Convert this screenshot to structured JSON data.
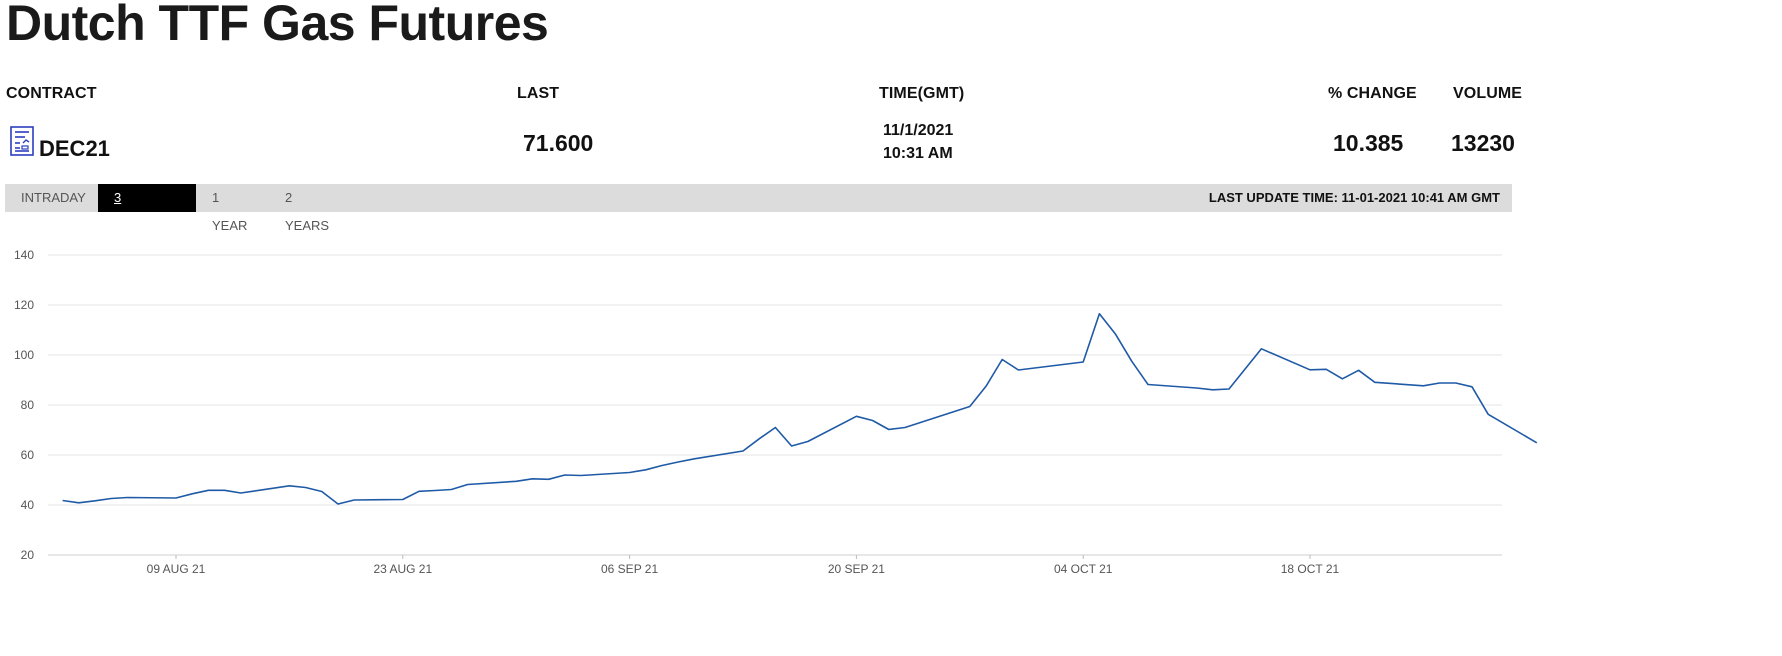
{
  "page": {
    "title": "Dutch TTF Gas Futures"
  },
  "quote": {
    "headers": {
      "contract": "CONTRACT",
      "last": "LAST",
      "time": "TIME(GMT)",
      "pct_change": "% CHANGE",
      "volume": "VOLUME"
    },
    "contract": "DEC21",
    "last": "71.600",
    "date": "11/1/2021",
    "time": "10:31 AM",
    "pct_change": "10.385",
    "volume": "13230",
    "icon": "contract-sheet-icon"
  },
  "tabs": [
    {
      "label": "INTRADAY",
      "active": false
    },
    {
      "label": "3 MONTHS",
      "active": true
    },
    {
      "label": "1 YEAR",
      "active": false
    },
    {
      "label": "2 YEARS",
      "active": false
    }
  ],
  "last_update": "LAST UPDATE TIME: 11-01-2021 10:41 AM GMT",
  "colors": {
    "line": "#1f5aa6",
    "grid": "#e6e6e6",
    "tabbar": "#dcdcdc",
    "active_tab": "#000000"
  },
  "chart_data": {
    "type": "line",
    "ylim": [
      20,
      140
    ],
    "yticks": [
      140,
      120,
      100,
      80,
      60,
      40,
      20
    ],
    "grid": "horizontal",
    "xticks": [
      {
        "label": "09 AUG 21",
        "date": "2021-08-09"
      },
      {
        "label": "23 AUG 21",
        "date": "2021-08-23"
      },
      {
        "label": "06 SEP 21",
        "date": "2021-09-06"
      },
      {
        "label": "20 SEP 21",
        "date": "2021-09-20"
      },
      {
        "label": "04 OCT 21",
        "date": "2021-10-04"
      },
      {
        "label": "18 OCT 21",
        "date": "2021-10-18"
      }
    ],
    "series": [
      {
        "points": [
          [
            "2021-08-02",
            41.8
          ],
          [
            "2021-08-03",
            40.9
          ],
          [
            "2021-08-04",
            41.7
          ],
          [
            "2021-08-05",
            42.6
          ],
          [
            "2021-08-06",
            43.0
          ],
          [
            "2021-08-09",
            42.8
          ],
          [
            "2021-08-10",
            44.5
          ],
          [
            "2021-08-11",
            45.9
          ],
          [
            "2021-08-12",
            45.9
          ],
          [
            "2021-08-13",
            44.8
          ],
          [
            "2021-08-16",
            47.7
          ],
          [
            "2021-08-17",
            47.0
          ],
          [
            "2021-08-18",
            45.4
          ],
          [
            "2021-08-19",
            40.4
          ],
          [
            "2021-08-20",
            42.0
          ],
          [
            "2021-08-23",
            42.2
          ],
          [
            "2021-08-24",
            45.5
          ],
          [
            "2021-08-25",
            45.8
          ],
          [
            "2021-08-26",
            46.2
          ],
          [
            "2021-08-27",
            48.2
          ],
          [
            "2021-08-30",
            49.5
          ],
          [
            "2021-08-31",
            50.5
          ],
          [
            "2021-09-01",
            50.3
          ],
          [
            "2021-09-02",
            52.0
          ],
          [
            "2021-09-03",
            51.8
          ],
          [
            "2021-09-06",
            53.0
          ],
          [
            "2021-09-07",
            54.1
          ],
          [
            "2021-09-08",
            55.8
          ],
          [
            "2021-09-09",
            57.2
          ],
          [
            "2021-09-10",
            58.5
          ],
          [
            "2021-09-13",
            61.6
          ],
          [
            "2021-09-14",
            66.5
          ],
          [
            "2021-09-15",
            71.0
          ],
          [
            "2021-09-16",
            63.6
          ],
          [
            "2021-09-17",
            65.4
          ],
          [
            "2021-09-20",
            75.5
          ],
          [
            "2021-09-21",
            73.8
          ],
          [
            "2021-09-22",
            70.2
          ],
          [
            "2021-09-23",
            71.0
          ],
          [
            "2021-09-27",
            79.4
          ],
          [
            "2021-09-28",
            87.5
          ],
          [
            "2021-09-29",
            98.2
          ],
          [
            "2021-09-30",
            94.0
          ],
          [
            "2021-10-01",
            94.8
          ],
          [
            "2021-10-04",
            97.2
          ],
          [
            "2021-10-05",
            116.5
          ],
          [
            "2021-10-06",
            108.3
          ],
          [
            "2021-10-07",
            97.5
          ],
          [
            "2021-10-08",
            88.2
          ],
          [
            "2021-10-11",
            86.8
          ],
          [
            "2021-10-12",
            86.1
          ],
          [
            "2021-10-13",
            86.4
          ],
          [
            "2021-10-15",
            102.5
          ],
          [
            "2021-10-18",
            94.1
          ],
          [
            "2021-10-19",
            94.3
          ],
          [
            "2021-10-20",
            90.5
          ],
          [
            "2021-10-21",
            93.9
          ],
          [
            "2021-10-22",
            89.1
          ],
          [
            "2021-10-25",
            87.7
          ],
          [
            "2021-10-26",
            88.8
          ],
          [
            "2021-10-27",
            88.8
          ],
          [
            "2021-10-28",
            87.3
          ],
          [
            "2021-10-29",
            76.3
          ],
          [
            "2021-11-01",
            64.9
          ]
        ]
      }
    ]
  }
}
